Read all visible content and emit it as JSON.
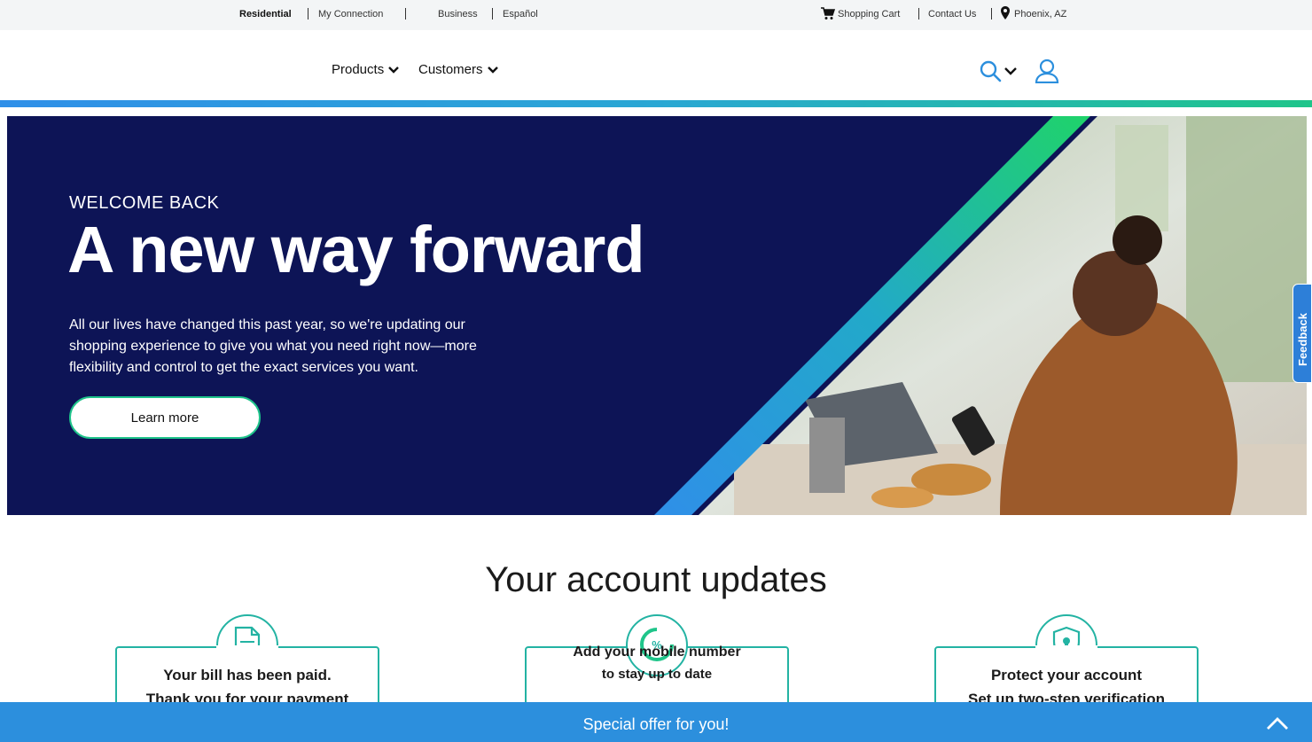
{
  "util_bar": {
    "residential": "Residential",
    "my_connection": "My Connection",
    "business": "Business",
    "espanol": "Español",
    "shopping_cart": "Shopping Cart",
    "contact_us": "Contact Us",
    "location": "Phoenix, AZ"
  },
  "nav": {
    "products": "Products",
    "customers": "Customers"
  },
  "hero": {
    "eyebrow": "WELCOME BACK",
    "title": "A new way forward",
    "body": "All our lives have changed this past year, so we're updating our shopping experience to give you what you need right now—more flexibility and control to get the exact services you want.",
    "button": "Learn more"
  },
  "feedback": "Feedback",
  "account_updates": {
    "title": "Your account updates",
    "cards": [
      {
        "icon": "document-icon",
        "line1": "Your bill has been paid.",
        "line2": "Thank you for your payment"
      },
      {
        "icon": "percent-icon",
        "line1": "Add your mobile number",
        "line2": "to stay up to date"
      },
      {
        "icon": "shield-lock-icon",
        "line1": "Protect your account",
        "line2": "Set up two-step verification"
      }
    ]
  },
  "promo": {
    "label": "Special offer for you!"
  },
  "colors": {
    "navy": "#0d1456",
    "teal": "#23b3a3",
    "blue": "#2c8fdd",
    "green": "#1ec38a"
  }
}
